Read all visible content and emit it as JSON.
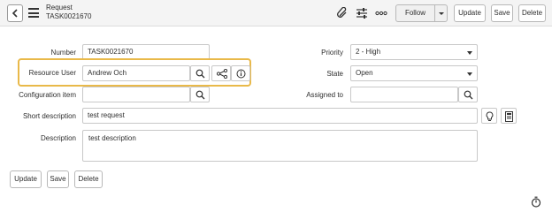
{
  "header": {
    "title": "Request",
    "number": "TASK0021670",
    "follow_label": "Follow",
    "update_label": "Update",
    "save_label": "Save",
    "delete_label": "Delete",
    "icons": [
      "back-icon",
      "hamburger-icon",
      "paperclip-icon",
      "settings-sliders-icon",
      "more-icon",
      "chevron-down-icon"
    ]
  },
  "form": {
    "number": {
      "label": "Number",
      "value": "TASK0021670"
    },
    "resource_user": {
      "label": "Resource User",
      "value": "Andrew Och"
    },
    "configuration_item": {
      "label": "Configuration item",
      "value": ""
    },
    "short_description": {
      "label": "Short description",
      "value": "test request"
    },
    "description": {
      "label": "Description",
      "value": "test description"
    },
    "priority": {
      "label": "Priority",
      "value": "2 - High"
    },
    "state": {
      "label": "State",
      "value": "Open"
    },
    "assigned_to": {
      "label": "Assigned to",
      "value": ""
    }
  },
  "footer": {
    "update_label": "Update",
    "save_label": "Save",
    "delete_label": "Delete"
  },
  "colors": {
    "highlight": "#e9b949",
    "header_bg": "#f4f4f4"
  }
}
